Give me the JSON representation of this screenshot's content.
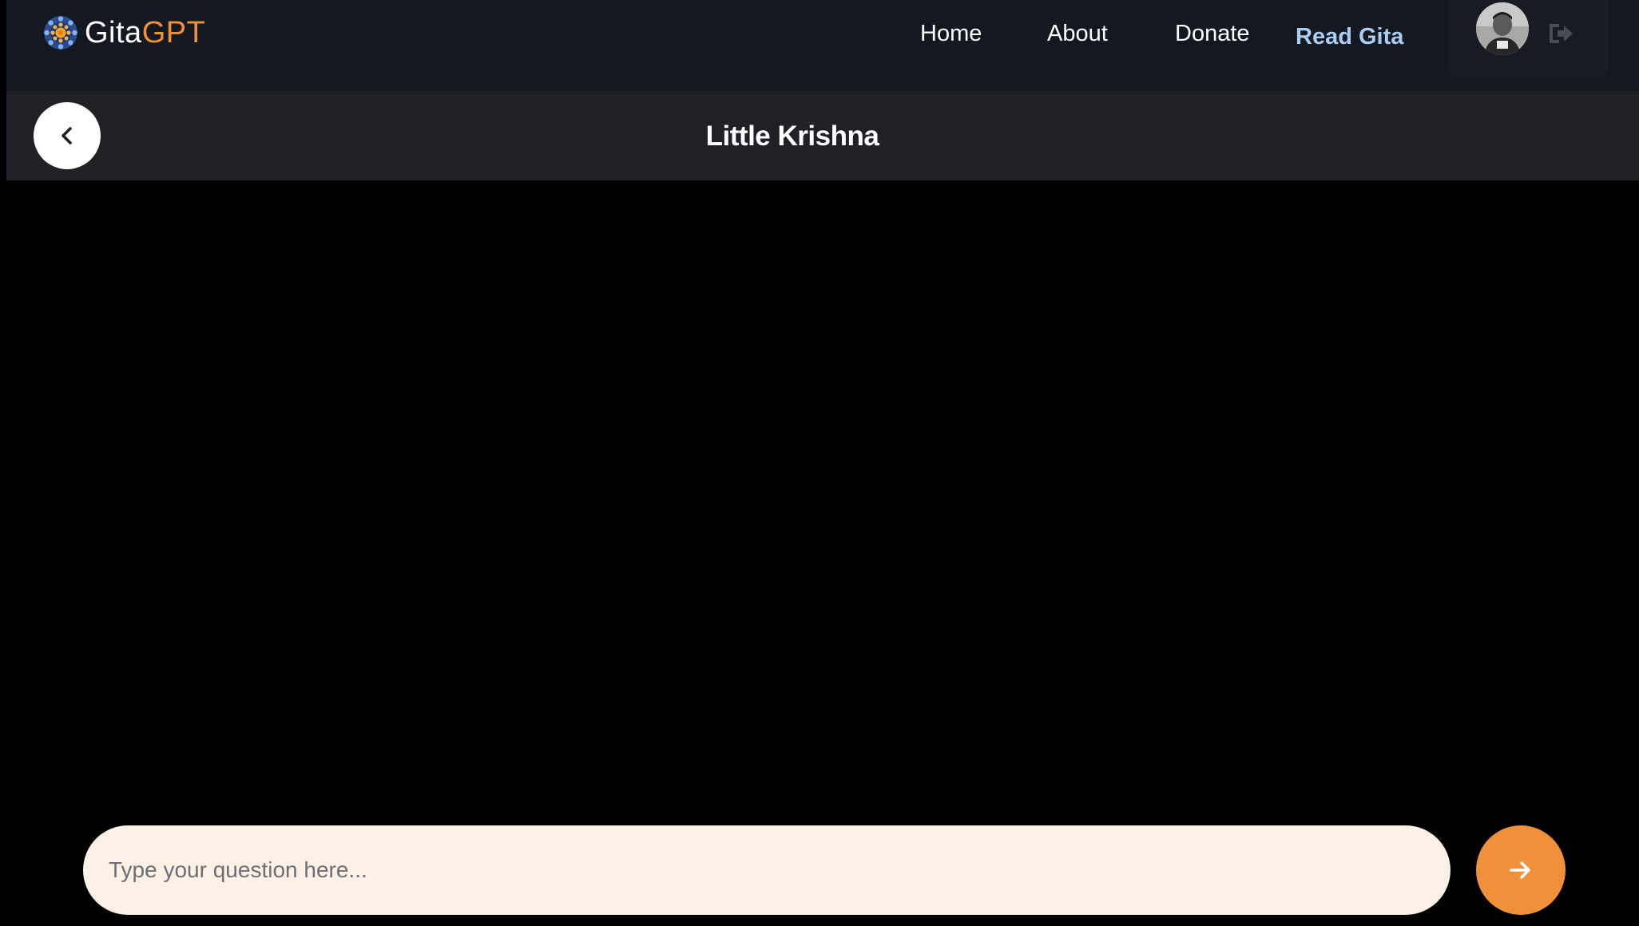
{
  "brand": {
    "name_part1": "Gita",
    "name_part2": "GPT",
    "logo_icon": "mandala-logo-icon"
  },
  "nav": {
    "items": [
      {
        "label": "Home"
      },
      {
        "label": "About"
      },
      {
        "label": "Donate"
      },
      {
        "label": "Read Gita"
      }
    ]
  },
  "user": {
    "avatar_icon": "user-avatar",
    "logout_icon": "logout-icon"
  },
  "chat": {
    "title": "Little Krishna",
    "back_icon": "chevron-left-icon"
  },
  "composer": {
    "placeholder": "Type your question here...",
    "value": "",
    "send_icon": "arrow-right-icon"
  },
  "colors": {
    "accent": "#f0913a",
    "nav_active": "#a9cdf3",
    "topbar_bg": "#141821",
    "header_bg": "#1f2126",
    "input_bg": "#fcf1e4",
    "page_bg": "#000000"
  }
}
